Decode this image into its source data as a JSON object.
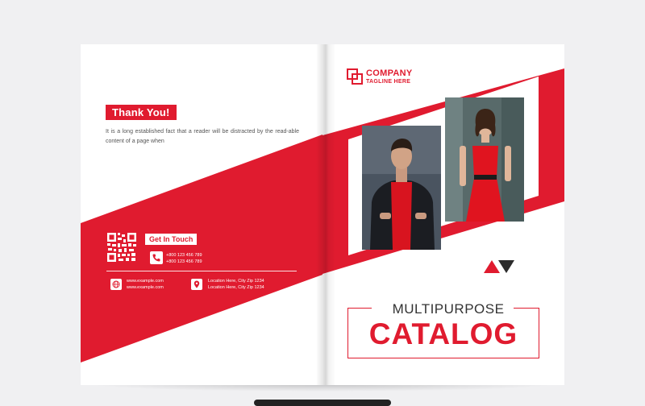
{
  "left_page": {
    "thank_you": "Thank You!",
    "intro_text": "It is a long established fact that a reader will be distracted by the read-able content of a page when",
    "get_in_touch": "Get In Touch",
    "phones": [
      "+800 123 456 789",
      "+800 123 456 789"
    ],
    "websites": [
      "www.example.com",
      "www.example.com"
    ],
    "locations": [
      "Location Here, City Zip  1234",
      "Location Here, City Zip  1234"
    ]
  },
  "right_page": {
    "company": "COMPANY",
    "tagline": "TAGLINE HERE",
    "title_top": "MULTIPURPOSE",
    "title_main": "CATALOG"
  },
  "colors": {
    "accent": "#e01b2f",
    "dark": "#2c2c2c",
    "background": "#f0f0f2"
  },
  "icons": [
    "qr-code-icon",
    "phone-icon",
    "globe-icon",
    "location-pin-icon",
    "company-logo-icon",
    "triangle-up-icon",
    "triangle-down-icon"
  ]
}
